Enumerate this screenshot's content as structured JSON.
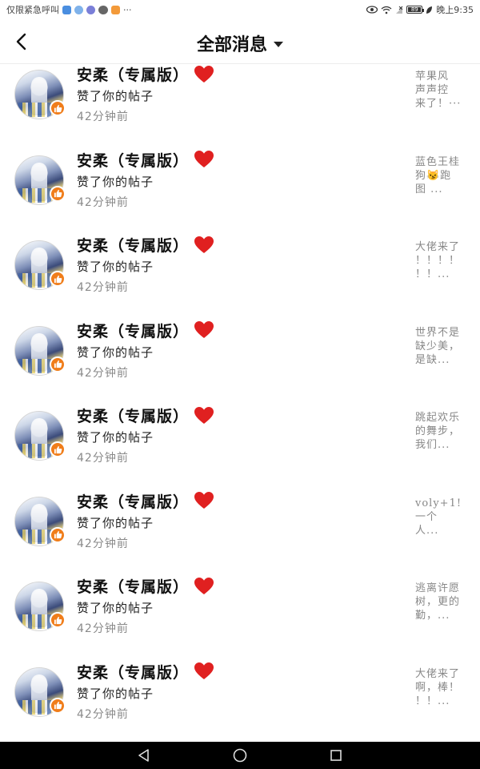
{
  "status_bar": {
    "left_text": "仅限紧急呼叫",
    "more": "···",
    "battery": "89",
    "time": "晚上9:35"
  },
  "header": {
    "title": "全部消息"
  },
  "colors": {
    "like_badge": "#f07d1a",
    "heart": "#e02020",
    "time_text": "#8a8a8a",
    "preview_text": "#888888"
  },
  "items": [
    {
      "name": "安柔（专属版）",
      "action": "赞了你的帖子",
      "time": "42分钟前",
      "preview": "苹果风\n声声控\n来了！···"
    },
    {
      "name": "安柔（专属版）",
      "action": "赞了你的帖子",
      "time": "42分钟前",
      "preview": "蓝色王桂\n狗😼跑\n图 ..."
    },
    {
      "name": "安柔（专属版）",
      "action": "赞了你的帖子",
      "time": "42分钟前",
      "preview": "大佬来了\n！！！！\n！！..."
    },
    {
      "name": "安柔（专属版）",
      "action": "赞了你的帖子",
      "time": "42分钟前",
      "preview": "世界不是\n缺少美，\n是缺..."
    },
    {
      "name": "安柔（专属版）",
      "action": "赞了你的帖子",
      "time": "42分钟前",
      "preview": "跳起欢乐\n的舞步，\n我们..."
    },
    {
      "name": "安柔（专属版）",
      "action": "赞了你的帖子",
      "time": "42分钟前",
      "preview": "voly+1!\n一个\n人..."
    },
    {
      "name": "安柔（专属版）",
      "action": "赞了你的帖子",
      "time": "42分钟前",
      "preview": "逃离许愿\n树，更的\n勤，..."
    },
    {
      "name": "安柔（专属版）",
      "action": "赞了你的帖子",
      "time": "42分钟前",
      "preview": "大佬来了\n啊，棒！\n！！..."
    }
  ]
}
